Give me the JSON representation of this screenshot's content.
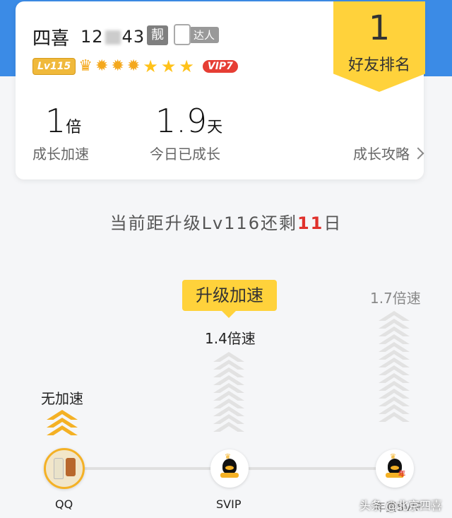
{
  "profile": {
    "name": "四喜",
    "qq_prefix": "12",
    "qq_suffix": "43",
    "liang_label": "靓",
    "daren_label": "达人",
    "level_badge": "Lv115",
    "vip_badge": "VIP7"
  },
  "rank": {
    "value": "1",
    "label": "好友排名"
  },
  "stats": {
    "speed_value": "1",
    "speed_unit": "倍",
    "speed_label": "成长加速",
    "today_value": "1.9",
    "today_unit": "天",
    "today_label": "今日已成长"
  },
  "guide_link": "成长攻略",
  "remain": {
    "prefix": "当前距升级Lv116还剩",
    "days": "11",
    "suffix": "日"
  },
  "upgrade": {
    "button": "升级加速",
    "none_label": "无加速",
    "svip_mult": "1.4倍速",
    "max_mult": "1.7倍速"
  },
  "nodes": [
    {
      "label": "QQ"
    },
    {
      "label": "SVIP"
    },
    {
      "label": "年费SVIP"
    }
  ],
  "watermark": "头条 @北京四喜",
  "colors": {
    "accent": "#ffd23b",
    "blue": "#3b8be6",
    "red": "#e0312c",
    "gold": "#f4b125"
  }
}
